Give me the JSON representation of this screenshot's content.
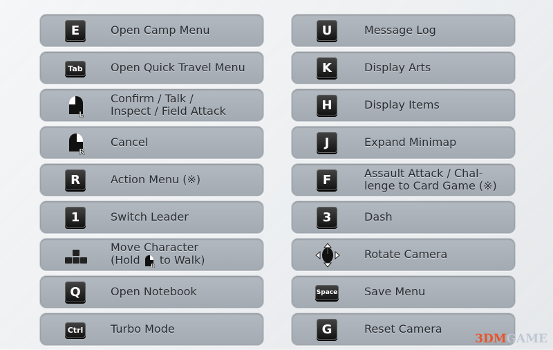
{
  "left": [
    {
      "key": "E",
      "icon": "key-e",
      "label": "Open Camp Menu"
    },
    {
      "key": "Tab",
      "icon": "key-tab",
      "label": "Open Quick Travel Menu"
    },
    {
      "icon": "mouse-left-button-icon",
      "line1": "Confirm / Talk /",
      "line2": "Inspect / Field Attack"
    },
    {
      "icon": "mouse-right-button-icon",
      "label": "Cancel"
    },
    {
      "key": "R",
      "icon": "key-r",
      "label": "Action Menu (※)"
    },
    {
      "key": "1",
      "icon": "key-1",
      "label": "Switch Leader"
    },
    {
      "icon": "wasd-keys-icon",
      "line1": "Move Character",
      "line2a": "(Hold ",
      "line2b": " to Walk)"
    },
    {
      "key": "Q",
      "icon": "key-q",
      "label": "Open Notebook"
    },
    {
      "key": "Ctrl",
      "icon": "key-ctrl",
      "label": "Turbo Mode"
    }
  ],
  "right": [
    {
      "key": "U",
      "label": "Message Log"
    },
    {
      "key": "K",
      "label": "Display Arts"
    },
    {
      "key": "H",
      "label": "Display Items"
    },
    {
      "key": "J",
      "label": "Expand Minimap"
    },
    {
      "key": "F",
      "line1": "Assault Attack / Chal-",
      "line2": "lenge to Card Game (※)"
    },
    {
      "key": "3",
      "label": "Dash"
    },
    {
      "icon": "mouse-move-icon",
      "label": "Rotate Camera"
    },
    {
      "key": "Space",
      "label": "Save Menu"
    },
    {
      "key": "G",
      "label": "Reset Camera"
    }
  ],
  "watermark": {
    "a": "3DM",
    "b": "GAME"
  }
}
